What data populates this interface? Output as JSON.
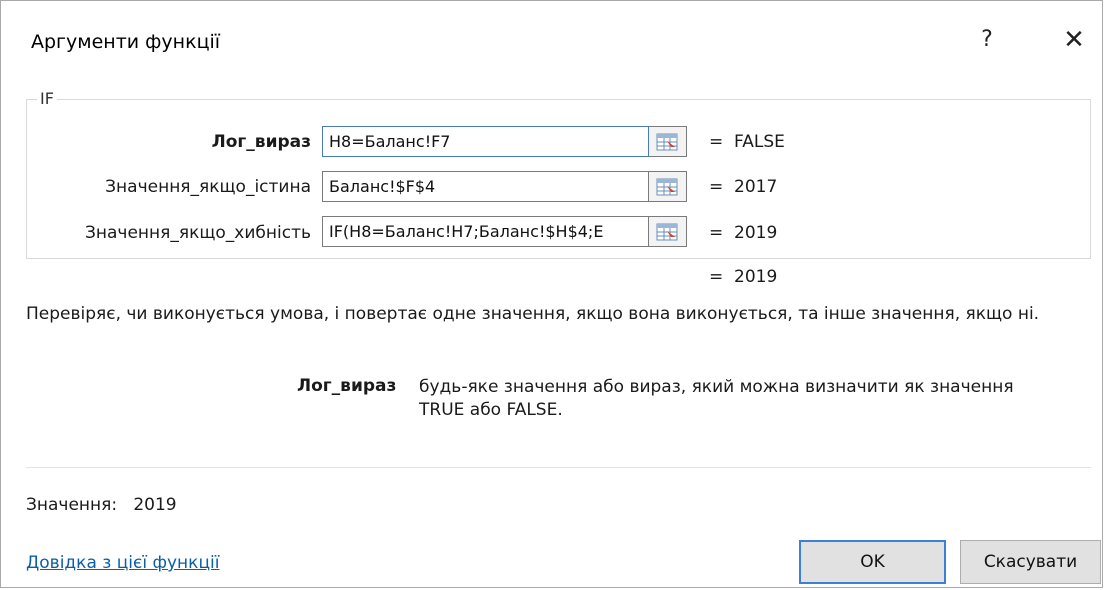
{
  "dialog": {
    "title": "Аргументи функції",
    "help_glyph": "?",
    "close_glyph": "✕"
  },
  "function": {
    "name": "IF",
    "args": [
      {
        "label": "Лог_вираз",
        "value": "H8=Баланс!F7",
        "result": "=  FALSE",
        "bold": true
      },
      {
        "label": "Значення_якщо_істина",
        "value": "Баланс!$F$4",
        "result": "=  2017",
        "bold": false
      },
      {
        "label": "Значення_якщо_хибність",
        "value": "IF(H8=Баланс!H7;Баланс!$H$4;E",
        "result": "=  2019",
        "bold": false
      }
    ],
    "formula_result": "=  2019",
    "description": "Перевіряє, чи виконується умова, і повертає одне значення, якщо вона виконується, та інше значення, якщо ні.",
    "arg_help_name": "Лог_вираз",
    "arg_help_text": "будь-яке значення або вираз, який можна визначити як значення TRUE або FALSE."
  },
  "footer": {
    "result_text": "Значення:   2019",
    "help_link": "Довідка з цієї функції",
    "ok_label": "OK",
    "cancel_label": "Скасувати"
  },
  "icons": {
    "ref": "range-select-icon",
    "accent": "#3c7fd6",
    "link_color": "#0b5fa5"
  }
}
